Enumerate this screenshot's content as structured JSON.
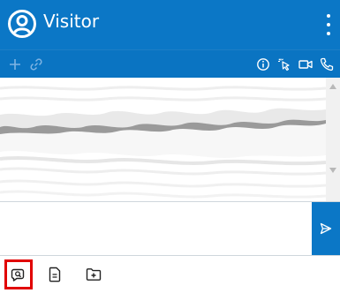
{
  "header": {
    "title": "Visitor",
    "avatar_icon": "user-circle-icon",
    "menu_icon": "more-vertical-icon"
  },
  "toolbar": {
    "left_icons": [
      "plus-icon",
      "link-icon"
    ],
    "right_icons": [
      "info-icon",
      "cursor-click-icon",
      "video-camera-icon",
      "phone-icon"
    ]
  },
  "composer": {
    "value": "",
    "placeholder": "",
    "send_icon": "send-icon"
  },
  "bottom_bar": {
    "items": [
      {
        "icon": "chat-search-icon",
        "active": true
      },
      {
        "icon": "document-icon",
        "active": false
      },
      {
        "icon": "folder-plus-icon",
        "active": false
      }
    ]
  },
  "colors": {
    "header": "#0b77c6",
    "toolbar": "#0a74c2",
    "highlight": "#e10000"
  }
}
